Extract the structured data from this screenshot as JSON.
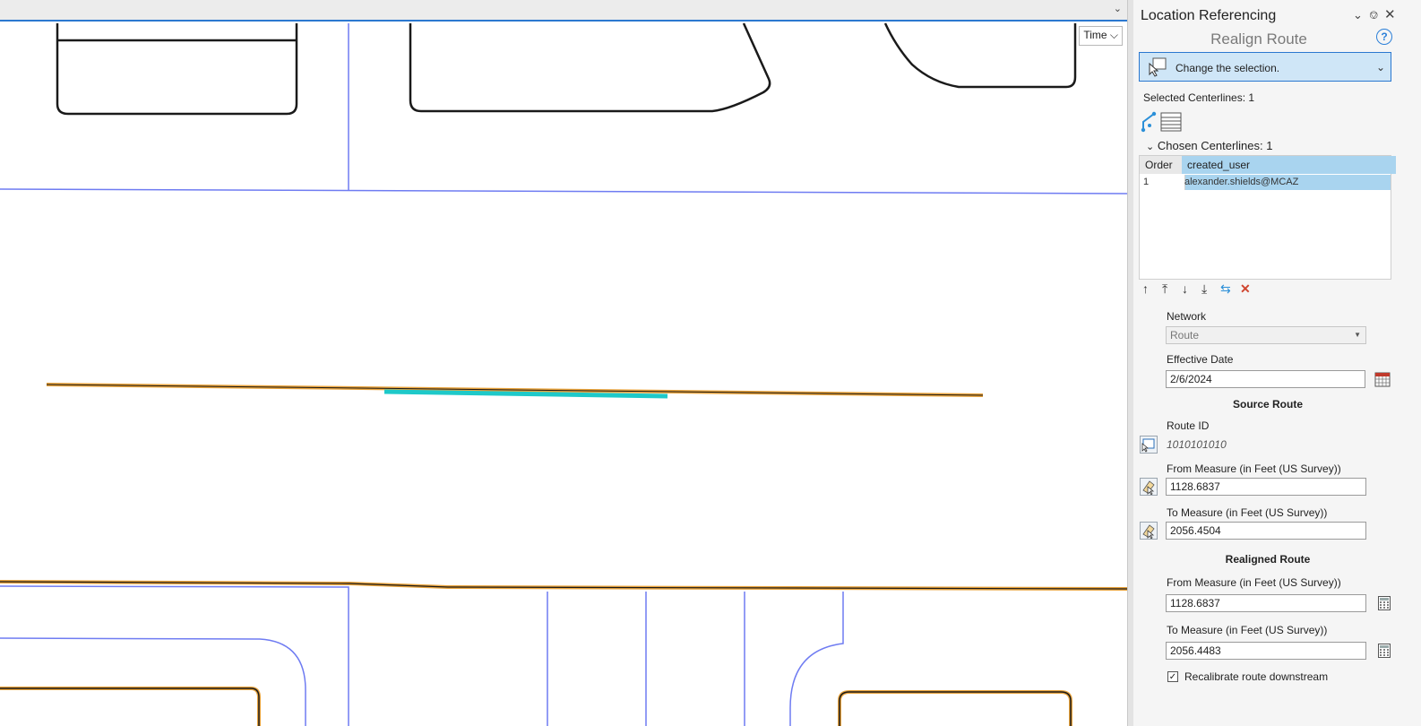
{
  "map": {
    "time_label": "Time",
    "colors": {
      "parcel": "#1a1a1a",
      "edge": "#6f7cf2",
      "route": "#e8a23a",
      "selection": "#1ec9c9"
    }
  },
  "panel": {
    "title": "Location Referencing",
    "subtitle": "Realign Route",
    "selection_dropdown": "Change the selection.",
    "selected_centerlines": "Selected Centerlines: 1",
    "chosen_centerlines": "Chosen Centerlines: 1",
    "table": {
      "columns": [
        "Order",
        "created_user"
      ],
      "rows": [
        [
          "1",
          "alexander.shields@MCAZ"
        ]
      ]
    },
    "network": {
      "label": "Network",
      "value": "Route"
    },
    "effective_date": {
      "label": "Effective Date",
      "value": "2/6/2024"
    },
    "source_route": {
      "heading": "Source Route",
      "route_id_label": "Route ID",
      "route_id_value": "1010101010",
      "from_label": "From Measure (in Feet (US Survey))",
      "from_value": "1128.6837",
      "to_label": "To Measure (in Feet (US Survey))",
      "to_value": "2056.4504"
    },
    "realigned_route": {
      "heading": "Realigned Route",
      "from_label": "From Measure (in Feet (US Survey))",
      "from_value": "1128.6837",
      "to_label": "To Measure (in Feet (US Survey))",
      "to_value": "2056.4483"
    },
    "recalibrate_label": "Recalibrate route downstream",
    "recalibrate_checked": "✓"
  }
}
